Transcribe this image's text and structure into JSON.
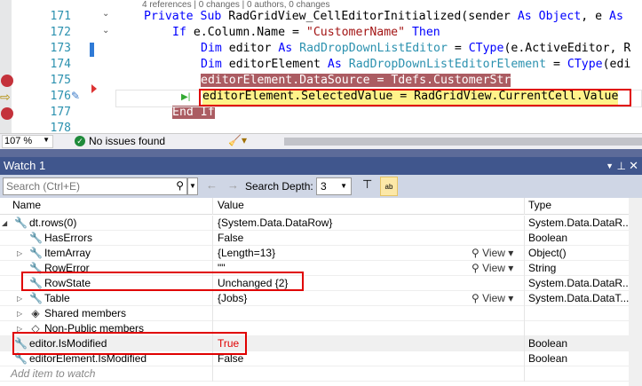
{
  "editor": {
    "codelens": "4 references | 0 changes | 0 authors, 0 changes",
    "lines": [
      {
        "num": "171",
        "tokens": [
          {
            "t": "Private Sub ",
            "c": "kw"
          },
          {
            "t": "RadGridView_CellEditorInitialized(sender ",
            "c": ""
          },
          {
            "t": "As ",
            "c": "kw"
          },
          {
            "t": "Object",
            "c": "kw"
          },
          {
            "t": ", e ",
            "c": ""
          },
          {
            "t": "As",
            "c": "kw"
          }
        ]
      },
      {
        "num": "172",
        "tokens": [
          {
            "t": "If ",
            "c": "kw"
          },
          {
            "t": "e.Column.Name = ",
            "c": ""
          },
          {
            "t": "\"CustomerName\"",
            "c": "st"
          },
          {
            "t": " Then",
            "c": "kw"
          }
        ]
      },
      {
        "num": "173",
        "tokens": [
          {
            "t": "Dim ",
            "c": "kw"
          },
          {
            "t": "editor ",
            "c": ""
          },
          {
            "t": "As ",
            "c": "kw"
          },
          {
            "t": "RadDropDownListEditor",
            "c": "ty"
          },
          {
            "t": " = ",
            "c": ""
          },
          {
            "t": "CType",
            "c": "kw"
          },
          {
            "t": "(e.ActiveEditor, R",
            "c": ""
          }
        ]
      },
      {
        "num": "174",
        "tokens": [
          {
            "t": "Dim ",
            "c": "kw"
          },
          {
            "t": "editorElement",
            "c": ""
          },
          {
            "t": " As ",
            "c": "kw"
          },
          {
            "t": "RadDropDownListEditorElement",
            "c": "ty"
          },
          {
            "t": " = ",
            "c": ""
          },
          {
            "t": "CType",
            "c": "kw"
          },
          {
            "t": "(edi",
            "c": ""
          }
        ]
      },
      {
        "num": "175",
        "tokens": [
          {
            "t": "editorElement.DataSource = Tdefs.CustomerStr",
            "c": "bphl"
          }
        ]
      },
      {
        "num": "176",
        "tokens": [
          {
            "t": "editorElement.SelectedValue = RadGridView.CurrentCell.Value",
            "c": ""
          }
        ]
      },
      {
        "num": "177",
        "tokens": [
          {
            "t": "End If",
            "c": "bphl"
          }
        ]
      },
      {
        "num": "178",
        "tokens": []
      }
    ]
  },
  "status": {
    "zoom": "107 %",
    "issues": "No issues found"
  },
  "watch": {
    "title": "Watch 1",
    "search_placeholder": "Search (Ctrl+E)",
    "search_depth_label": "Search Depth:",
    "search_depth_value": "3",
    "columns": [
      "Name",
      "Value",
      "Type"
    ],
    "rows": [
      {
        "name": "dt.rows(0)",
        "value": "{System.Data.DataRow}",
        "type": "System.Data.DataR...",
        "indent": 0,
        "expander": "expanded",
        "icon": "wrench-icon"
      },
      {
        "name": "HasErrors",
        "value": "False",
        "type": "Boolean",
        "indent": 1,
        "expander": "",
        "icon": "wrench-icon"
      },
      {
        "name": "ItemArray",
        "value": "{Length=13}",
        "type": "Object()",
        "indent": 1,
        "expander": "collapsed",
        "icon": "wrench-icon",
        "view": "View"
      },
      {
        "name": "RowError",
        "value": "\"\"",
        "type": "String",
        "indent": 1,
        "expander": "",
        "icon": "wrench-icon",
        "view": "View"
      },
      {
        "name": "RowState",
        "value": "Unchanged {2}",
        "type": "System.Data.DataR...",
        "indent": 1,
        "expander": "",
        "icon": "wrench-icon"
      },
      {
        "name": "Table",
        "value": "{Jobs}",
        "type": "System.Data.DataT...",
        "indent": 1,
        "expander": "collapsed",
        "icon": "wrench-icon",
        "view": "View"
      },
      {
        "name": "Shared members",
        "value": "",
        "type": "",
        "indent": 1,
        "expander": "collapsed",
        "icon": "shared-members-icon"
      },
      {
        "name": "Non-Public members",
        "value": "",
        "type": "",
        "indent": 1,
        "expander": "collapsed",
        "icon": "non-public-icon"
      },
      {
        "name": "editor.IsModified",
        "value": "True",
        "type": "Boolean",
        "indent": 0,
        "expander": "",
        "icon": "wrench-icon",
        "changed": true
      },
      {
        "name": "editorElement.IsModified",
        "value": "False",
        "type": "Boolean",
        "indent": 0,
        "expander": "",
        "icon": "wrench-icon"
      }
    ],
    "add_placeholder": "Add item to watch"
  },
  "colors": {
    "highlight_box": "#e00000",
    "breakpoint": "#c4323b",
    "changed_value": "#e00000",
    "title_bar": "#40568d"
  }
}
